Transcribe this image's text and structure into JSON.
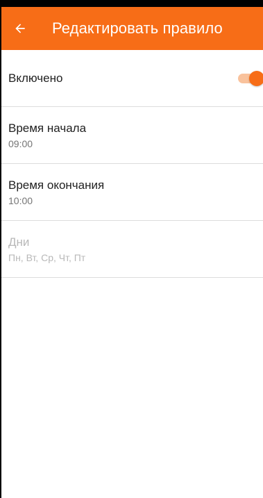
{
  "header": {
    "title": "Редактировать правило",
    "back_icon": "arrow-left-icon",
    "color": "#f76d17"
  },
  "settings": {
    "enabled": {
      "label": "Включено",
      "on": true
    },
    "start_time": {
      "label": "Время начала",
      "value": "09:00"
    },
    "end_time": {
      "label": "Время окончания",
      "value": "10:00"
    },
    "days": {
      "label": "Дни",
      "value": "Пн, Вт, Ср, Чт, Пт",
      "disabled": true
    }
  }
}
